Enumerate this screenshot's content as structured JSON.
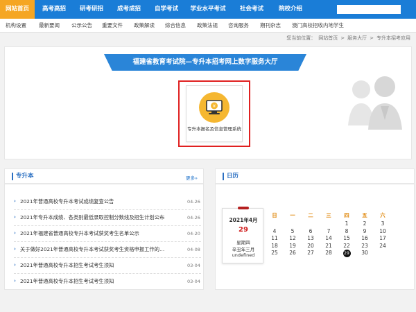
{
  "topnav": {
    "items": [
      "网站首页",
      "高考高招",
      "研考研招",
      "成考成招",
      "自学考试",
      "学业水平考试",
      "社会考试",
      "院校介绍"
    ],
    "search_placeholder": ""
  },
  "subnav": {
    "items": [
      "机构设置",
      "最新要闻",
      "公示公告",
      "重要文件",
      "政策解读",
      "综合信息",
      "政策法规",
      "咨询服务",
      "期刊杂志",
      "澳门高校招收内地学生"
    ]
  },
  "breadcrumb": {
    "label": "您当前位置：",
    "items": [
      "网站首页",
      ">",
      "服务大厅",
      ">",
      "专升本招考应用"
    ]
  },
  "hero": {
    "banner": "福建省教育考试院—专升本招考网上数字服务大厅",
    "service_label": "专升本报名及信息管理系统",
    "icon": "monitor-yen-icon",
    "accent": "#f5b731",
    "highlight": "#e02020"
  },
  "news": {
    "title": "专升本",
    "more": "更多»",
    "items": [
      {
        "title": "2021年普通高校专升本考试成绩复查公告",
        "date": "04-26"
      },
      {
        "title": "2021年专升本成绩、各类别最低录取控制分数线及招生计划公布",
        "date": "04-26"
      },
      {
        "title": "2021年福建省普通高校专升本考试获奖考生名单公示",
        "date": "04-20"
      },
      {
        "title": "关于做好2021年普通高校专升本考试获奖考生资格申报工作的…",
        "date": "04-08"
      },
      {
        "title": "2021年普通高校专升本招生考试考生须知",
        "date": "03-04"
      },
      {
        "title": "2021年普通高校专升本招生考试考生须知",
        "date": "03-04"
      }
    ]
  },
  "calendar": {
    "title": "日历",
    "card": {
      "month": "2021年4月",
      "day": "29",
      "weekday": "星期四",
      "lunar": "辛丑年三月",
      "extra": "undefined"
    },
    "headers": [
      "日",
      "一",
      "二",
      "三",
      "四",
      "五",
      "六"
    ],
    "weeks": [
      [
        "",
        "",
        "",
        "",
        "1",
        "2",
        "3"
      ],
      [
        "4",
        "5",
        "6",
        "7",
        "8",
        "9",
        "10"
      ],
      [
        "11",
        "12",
        "13",
        "14",
        "15",
        "16",
        "17"
      ],
      [
        "18",
        "19",
        "20",
        "21",
        "22",
        "23",
        "24"
      ],
      [
        "25",
        "26",
        "27",
        "28",
        "29",
        "30",
        ""
      ]
    ],
    "today": "29"
  },
  "colors": {
    "nav_bg": "#1a7dd7",
    "nav_active": "#f5a623",
    "title_blue": "#2a6fc2",
    "weekday_orange": "#e08a10"
  }
}
